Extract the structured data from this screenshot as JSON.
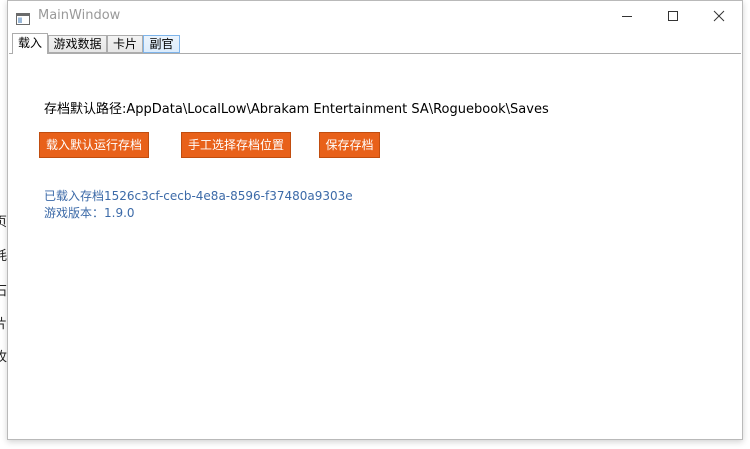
{
  "background_fragment": {
    "chars": [
      ":",
      "页",
      "耗",
      "石",
      "片",
      "牧"
    ]
  },
  "window": {
    "title": "MainWindow",
    "icon": "app-window-icon",
    "controls": {
      "minimize_icon": "minimize-icon",
      "maximize_icon": "maximize-icon",
      "close_icon": "close-icon"
    }
  },
  "tabs": [
    {
      "label": "载入",
      "active": true
    },
    {
      "label": "游戏数据",
      "active": false
    },
    {
      "label": "卡片",
      "active": false
    },
    {
      "label": "副官",
      "active": false
    }
  ],
  "load_tab": {
    "default_path": "存档默认路径:AppData\\LocalLow\\Abrakam Entertainment SA\\Roguebook\\Saves",
    "buttons": {
      "load_default": "载入默认运行存档",
      "manual_select": "手工选择存档位置",
      "save": "保存存档"
    },
    "status": {
      "loaded_save": "已载入存档1526c3cf-cecb-4e8a-8596-f37480a9303e",
      "game_version": "游戏版本：1.9.0"
    }
  },
  "colors": {
    "button_bg": "#e8611a",
    "info_text": "#3c6aa8"
  }
}
